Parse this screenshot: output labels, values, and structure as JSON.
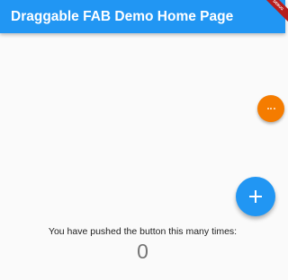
{
  "app_bar": {
    "title": "Draggable FAB Demo Home Page",
    "color": "#2196f3"
  },
  "debug_banner": {
    "label": "DEBUG",
    "color": "#b71c1c"
  },
  "drag_fab": {
    "icon": "more-horiz-icon",
    "color": "#f57c00"
  },
  "add_fab": {
    "icon": "add-icon",
    "color": "#2196f3"
  },
  "counter": {
    "label": "You have pushed the button this many times:",
    "value": "0"
  }
}
